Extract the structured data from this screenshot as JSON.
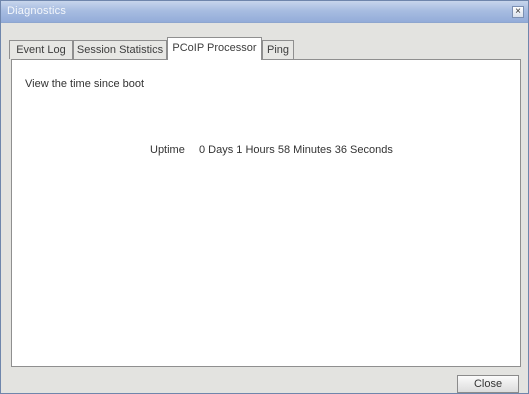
{
  "window": {
    "title": "Diagnostics",
    "close_glyph": "×"
  },
  "tabs": [
    {
      "label": "Event Log",
      "active": false
    },
    {
      "label": "Session Statistics",
      "active": false
    },
    {
      "label": "PCoIP Processor",
      "active": true
    },
    {
      "label": "Ping",
      "active": false
    }
  ],
  "panel": {
    "description": "View the time since boot",
    "uptime_label": "Uptime",
    "uptime_value": "0 Days 1 Hours 58 Minutes 36 Seconds"
  },
  "footer": {
    "close_label": "Close"
  },
  "colors": {
    "titlebar": "#a8bde1",
    "window_bg": "#e3e3e0",
    "panel_bg": "#ffffff"
  }
}
